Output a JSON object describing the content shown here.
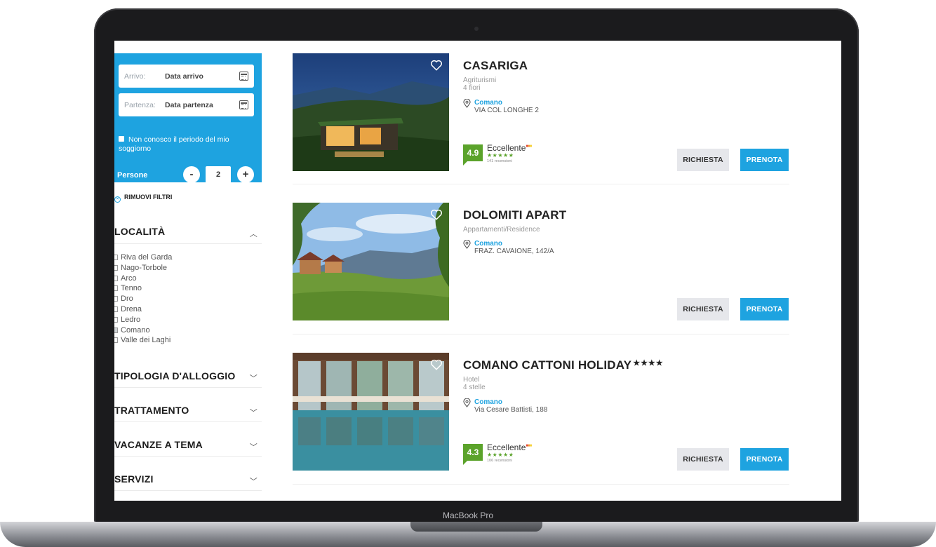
{
  "device": {
    "brand_label": "MacBook Pro"
  },
  "booking": {
    "arrival_label": "Arrivo:",
    "arrival_value": "Data arrivo",
    "departure_label": "Partenza:",
    "departure_value": "Data partenza",
    "unknown_period_label": "Non conosco il periodo del mio soggiorno",
    "unknown_period_checked": true,
    "people_label": "Persone",
    "people_minus": "-",
    "people_value": "2",
    "people_plus": "+"
  },
  "filters": {
    "remove_label": "RIMUOVI FILTRI",
    "localita": {
      "title": "LOCALITÀ",
      "expanded": true,
      "items": [
        {
          "label": "Riva del Garda",
          "checked": false
        },
        {
          "label": "Nago-Torbole",
          "checked": false
        },
        {
          "label": "Arco",
          "checked": false
        },
        {
          "label": "Tenno",
          "checked": false
        },
        {
          "label": "Dro",
          "checked": false
        },
        {
          "label": "Drena",
          "checked": false
        },
        {
          "label": "Ledro",
          "checked": false
        },
        {
          "label": "Comano",
          "checked": true
        },
        {
          "label": "Valle dei Laghi",
          "checked": false
        }
      ]
    },
    "tipologia": {
      "title": "TIPOLOGIA D'ALLOGGIO"
    },
    "trattamento": {
      "title": "TRATTAMENTO"
    },
    "vacanze": {
      "title": "VACANZE A TEMA"
    },
    "servizi": {
      "title": "SERVIZI"
    }
  },
  "listings": [
    {
      "name": "CASARIGA",
      "stars": "",
      "type": "Agriturismi",
      "category": "4 fiori",
      "city": "Comano",
      "address": "VIA COL LONGHE 2",
      "score": "4.9",
      "rating_word": "Eccellente",
      "rating_stars": "★★★★★",
      "reviews": "141 recensioni",
      "request_label": "RICHIESTA",
      "book_label": "PRENOTA"
    },
    {
      "name": "DOLOMITI APART",
      "stars": "",
      "type": "Appartamenti/Residence",
      "category": "",
      "city": "Comano",
      "address": "FRAZ. CAVAIONE, 142/A",
      "request_label": "RICHIESTA",
      "book_label": "PRENOTA"
    },
    {
      "name": "COMANO CATTONI HOLIDAY",
      "stars": "★★★★",
      "type": "Hotel",
      "category": "4 stelle",
      "city": "Comano",
      "address": "Via Cesare Battisti, 188",
      "score": "4.3",
      "rating_word": "Eccellente",
      "rating_stars": "★★★★★",
      "reviews": "106 recensioni",
      "request_label": "RICHIESTA",
      "book_label": "PRENOTA"
    }
  ],
  "colors": {
    "accent": "#1ea3e0",
    "score_green": "#5ba32b",
    "button_grey": "#e6e7eb"
  },
  "icons": [
    "calendar-icon",
    "heart-icon",
    "location-pin-icon",
    "chevron-up-icon",
    "chevron-down-icon",
    "close-circle-icon"
  ]
}
